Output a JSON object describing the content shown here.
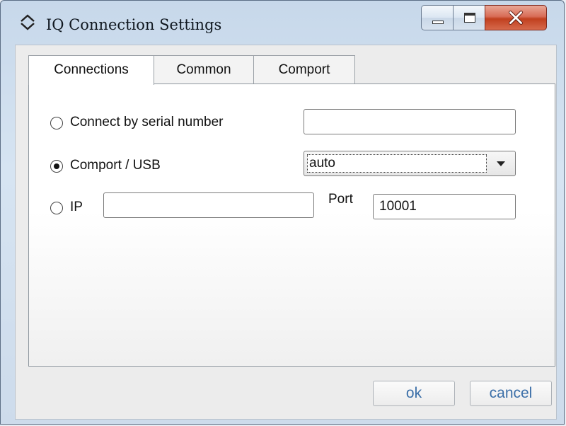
{
  "window": {
    "title": "IQ Connection Settings",
    "controls": [
      "minimize",
      "maximize",
      "close"
    ]
  },
  "tabs": [
    {
      "label": "Connections",
      "active": true
    },
    {
      "label": "Common",
      "active": false
    },
    {
      "label": "Comport",
      "active": false
    }
  ],
  "connections": {
    "serial": {
      "label": "Connect by serial number",
      "selected": false,
      "value": ""
    },
    "comport": {
      "label": "Comport / USB",
      "selected": true,
      "value": "auto"
    },
    "ip": {
      "label": "IP",
      "selected": false,
      "value": "",
      "port_label": "Port",
      "port_value": "10001"
    }
  },
  "buttons": {
    "ok": "ok",
    "cancel": "cancel"
  },
  "colors": {
    "title_bar": "#d6e4f2",
    "close_button": "#c1401f",
    "button_text": "#3b6fa8"
  }
}
